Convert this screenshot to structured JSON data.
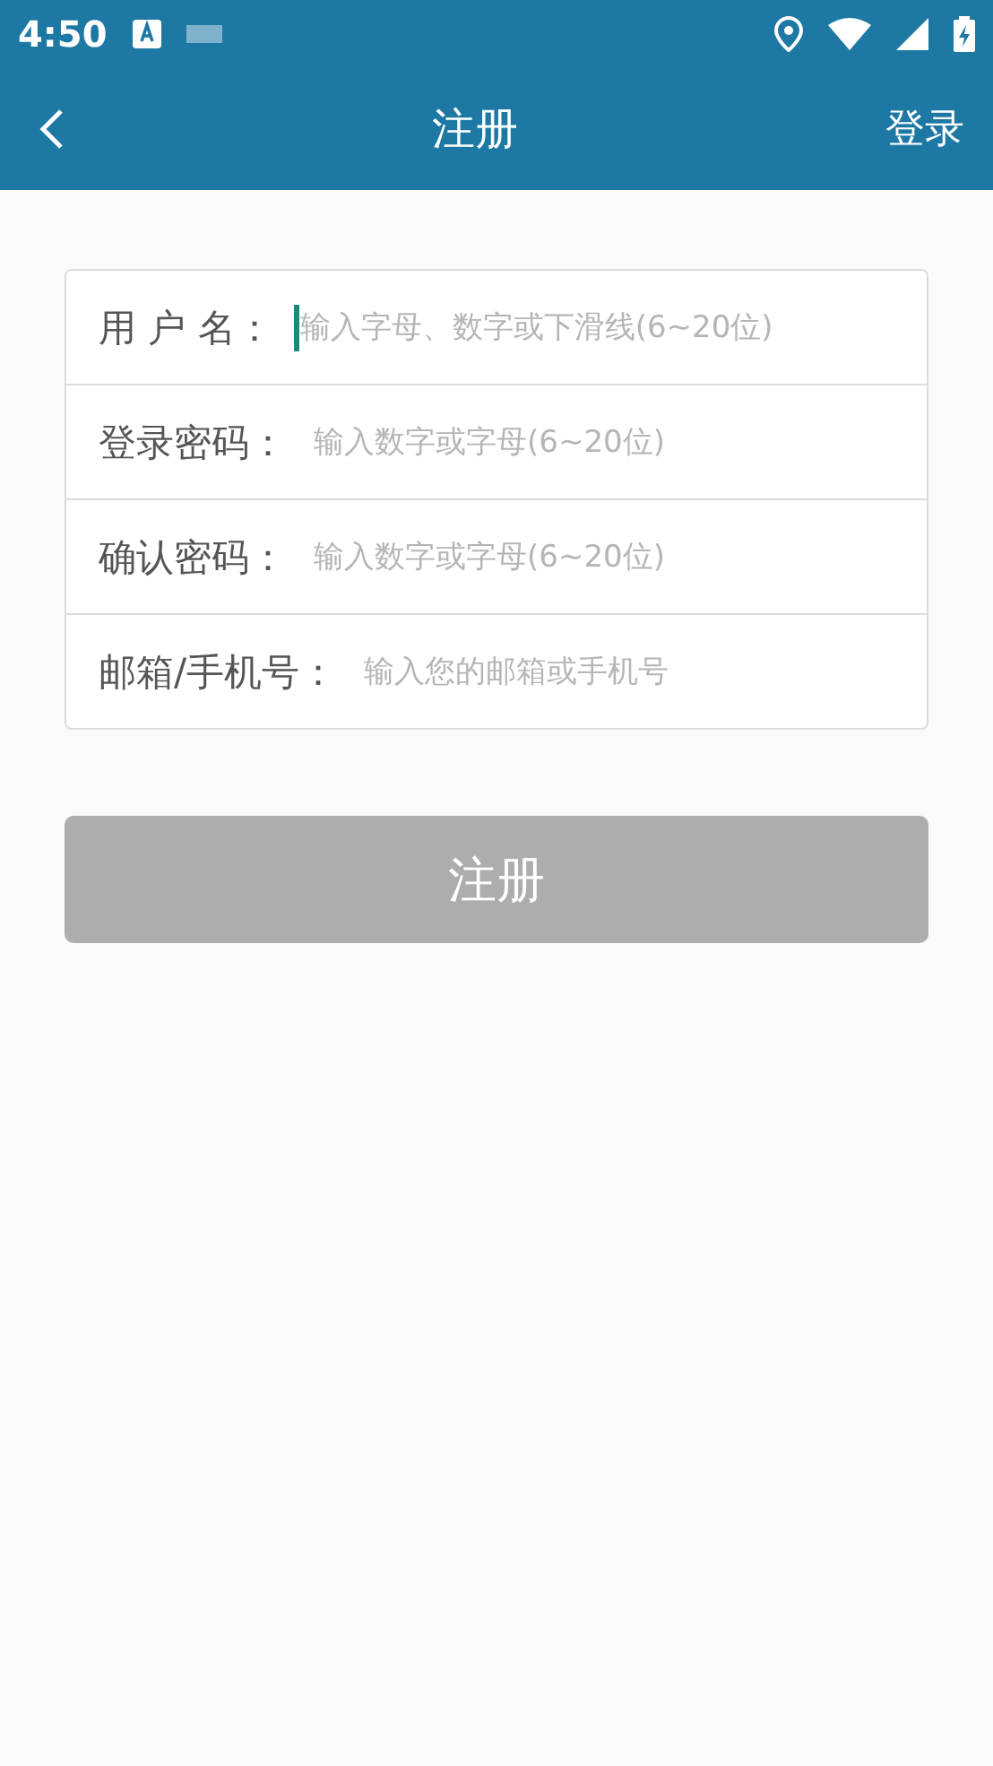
{
  "status_bar": {
    "time": "4:50"
  },
  "app_bar": {
    "title": "注册",
    "action": "登录"
  },
  "fields": [
    {
      "label": "用 户 名：",
      "placeholder": "输入字母、数字或下滑线(6~20位)",
      "focused": true
    },
    {
      "label": "登录密码：",
      "placeholder": "输入数字或字母(6~20位)",
      "focused": false
    },
    {
      "label": "确认密码：",
      "placeholder": "输入数字或字母(6~20位)",
      "focused": false
    },
    {
      "label": "邮箱/手机号：",
      "placeholder": "输入您的邮箱或手机号",
      "focused": false
    }
  ],
  "submit": {
    "label": "注册",
    "disabled": true
  }
}
